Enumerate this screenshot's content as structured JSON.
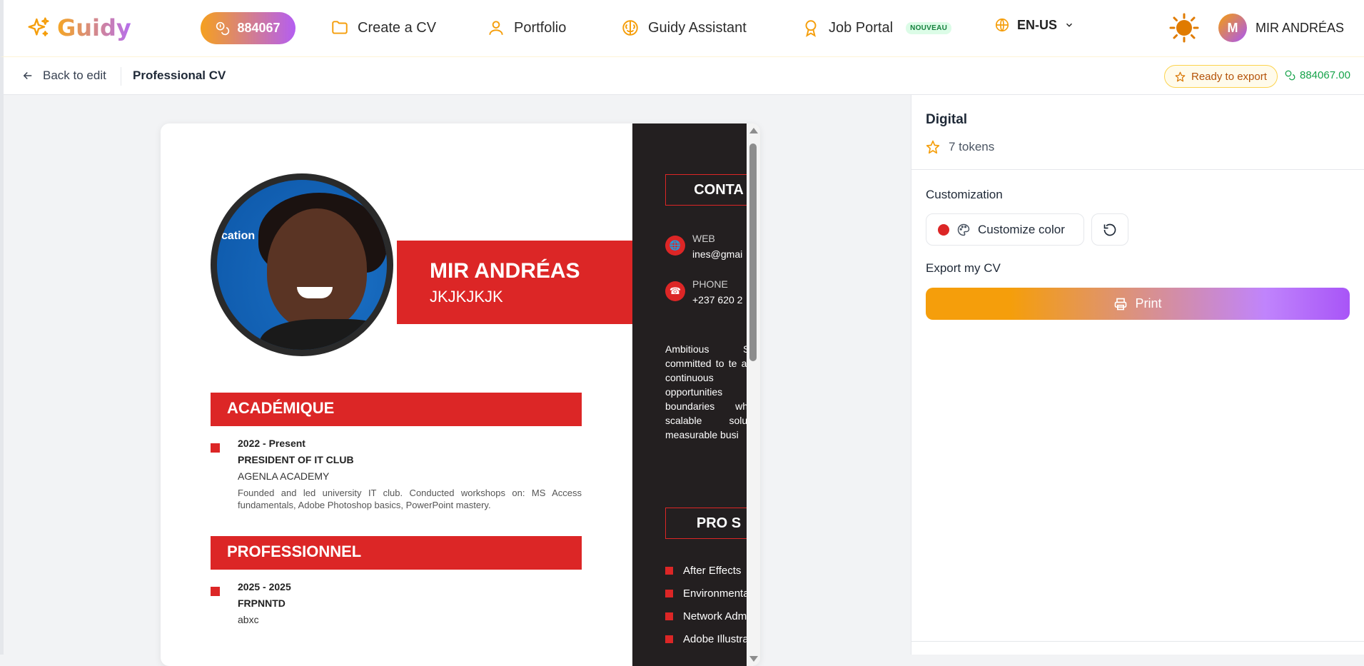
{
  "brand": {
    "name": "Guidy"
  },
  "header": {
    "token_count": "884067",
    "nav": [
      {
        "label": "Create a CV",
        "icon": "folder-icon"
      },
      {
        "label": "Portfolio",
        "icon": "user-icon"
      },
      {
        "label": "Guidy Assistant",
        "icon": "brain-icon"
      },
      {
        "label": "Job Portal",
        "icon": "award-icon",
        "badge": "NOUVEAU"
      }
    ],
    "language": "EN-US",
    "user": {
      "initial": "M",
      "name": "MIR ANDRÉAS"
    }
  },
  "subbar": {
    "back_label": "Back to edit",
    "doc_title": "Professional CV",
    "status": "Ready to export",
    "balance": "884067.00"
  },
  "cv": {
    "photo_caption": "cation",
    "name": "MIR ANDRÉAS",
    "subtitle": "JKJKJKJK",
    "sections": [
      {
        "title": "ACADÉMIQUE",
        "entries": [
          {
            "date": "2022 - Present",
            "title": "PRESIDENT OF IT CLUB",
            "org": "AGENLA ACADEMY",
            "desc": "Founded and led university IT club. Conducted workshops on: MS Access fundamentals, Adobe Photoshop basics, PowerPoint mastery."
          }
        ]
      },
      {
        "title": "PROFESSIONNEL",
        "entries": [
          {
            "date": "2025 - 2025",
            "title": "FRPNNTD",
            "org": "abxc",
            "desc": ""
          }
        ]
      }
    ],
    "contact": {
      "heading": "CONTA",
      "web_label": "WEB",
      "web_value": "ines@gmai",
      "phone_label": "PHONE",
      "phone_value": "+237 620 2"
    },
    "summary": "Ambitious Sof committed to te and continuous opportunities to boundaries while scalable solutio measurable busi",
    "skills": {
      "heading": "PRO S",
      "items": [
        "After Effects",
        "Environmental",
        "Network Adm",
        "Adobe Illustra"
      ]
    },
    "accent_color": "#dc2626"
  },
  "panel": {
    "template_name": "Digital",
    "tokens": "7 tokens",
    "customization_title": "Customization",
    "customize_label": "Customize color",
    "export_title": "Export my CV",
    "print_label": "Print"
  }
}
